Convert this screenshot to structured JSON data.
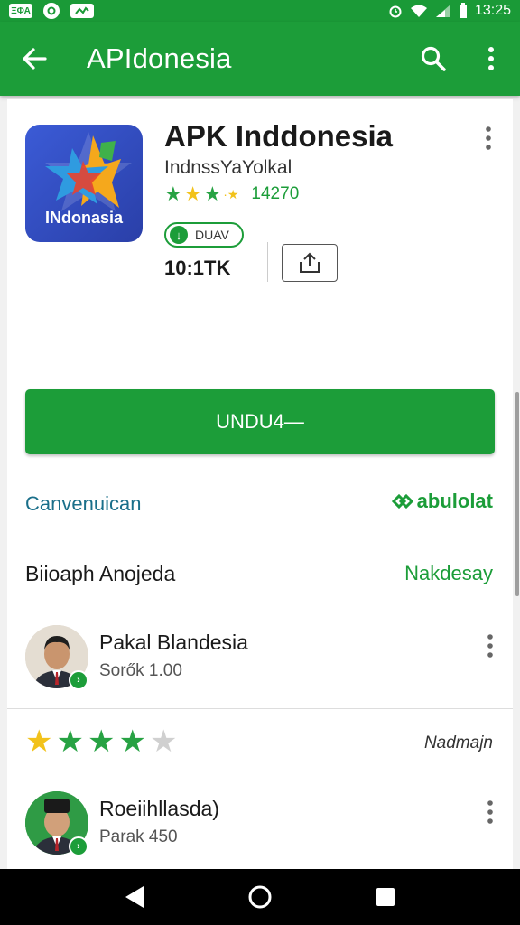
{
  "status_bar": {
    "notif1": "ΞΦΑ",
    "notif3": "ⓟ",
    "time": "13:25"
  },
  "app_bar": {
    "title": "APIdonesia"
  },
  "app": {
    "name": "APK Inddonesia",
    "developer": "IndnѕѕYaYolkal",
    "icon_label": "INdonasia",
    "rating_count": "14270",
    "badge_label": "DUAV",
    "size": "10:1TK"
  },
  "install_button": "UNDU4—",
  "links": {
    "left": "Canvenuican",
    "right": "abulolat"
  },
  "section": {
    "title": "Biioaph Anojeda",
    "action": "Nakdesay"
  },
  "reviews": [
    {
      "name": "Pakal Blandesia",
      "meta": "Sorők 1.00"
    },
    {
      "name": "Roeiihllasda)",
      "meta": "Parak 450"
    }
  ],
  "stars_label": "Nadmajn",
  "colors": {
    "primary_green": "#1c9d39",
    "star_yellow": "#f2c21b",
    "star_green": "#27a243",
    "link_blue": "#1a6f8a"
  }
}
